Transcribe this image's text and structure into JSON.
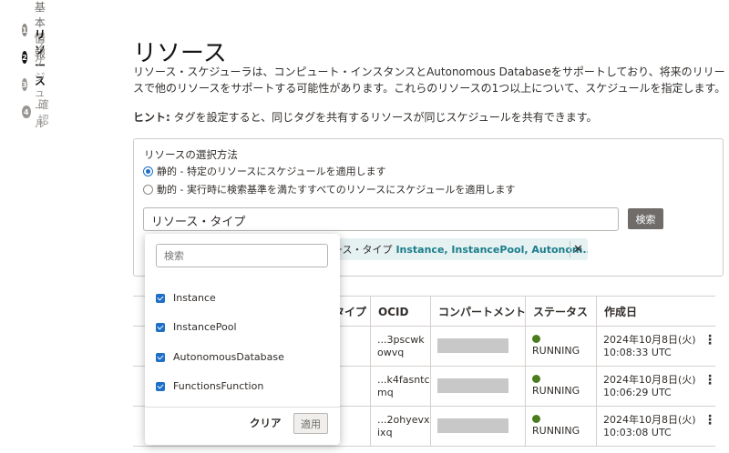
{
  "steps": [
    {
      "num": "1",
      "label": "基本情報"
    },
    {
      "num": "2",
      "label": "リソース"
    },
    {
      "num": "3",
      "label": "スケジュール"
    },
    {
      "num": "4",
      "label": "確認"
    }
  ],
  "page": {
    "title": "リソース",
    "description": "リソース・スケジューラは、コンピュート・インスタンスとAutonomous Databaseをサポートしており、将来のリリースで他のリソースをサポートする可能性があります。これらのリソースの1つ以上について、スケジュールを指定します。",
    "hint_label": "ヒント:",
    "hint_text": " タグを設定すると、同じタグを共有するリソースが同じスケジュールを共有できます。"
  },
  "selection": {
    "label": "リソースの選択方法",
    "options": [
      {
        "label": "静的 - 特定のリソースにスケジュールを適用します",
        "selected": true
      },
      {
        "label": "動的 - 実行時に検索基準を満たすすべてのリソースにスケジュールを適用します",
        "selected": false
      }
    ],
    "type_input_value": "リソース・タイプ",
    "search_button": "検索",
    "chip_key": "ース・タイプ",
    "chip_value": "Instance, InstancePool, Autonom...",
    "chip_close": "✕"
  },
  "table": {
    "headers": [
      "タイプ",
      "OCID",
      "コンパートメント",
      "ステータス",
      "作成日"
    ],
    "rows": [
      {
        "ocid_line1": "...3pscwk",
        "ocid_line2": "owvq",
        "status": "RUNNING",
        "created_line1": "2024年10月8日(火)",
        "created_line2": "10:08:33 UTC"
      },
      {
        "ocid_line1": "...k4fasntc",
        "ocid_line2": "mq",
        "status": "RUNNING",
        "created_line1": "2024年10月8日(火)",
        "created_line2": "10:06:29 UTC"
      },
      {
        "ocid_line1": "...2ohyevx",
        "ocid_line2": "ixq",
        "status": "RUNNING",
        "created_line1": "2024年10月8日(火)",
        "created_line2": "10:03:08 UTC"
      }
    ],
    "row_menu_glyph": "⋮"
  },
  "dropdown": {
    "search_placeholder": "検索",
    "items": [
      {
        "label": "Instance",
        "checked": true
      },
      {
        "label": "InstancePool",
        "checked": true
      },
      {
        "label": "AutonomousDatabase",
        "checked": true
      },
      {
        "label": "FunctionsFunction",
        "checked": true
      }
    ],
    "clear_label": "クリア",
    "apply_label": "適用"
  },
  "colors": {
    "accent_blue": "#1e6fc7",
    "chip_bg": "#e6f1f2",
    "chip_text": "#1a7d8a",
    "running_green": "#4b7d1e",
    "button_gray": "#6f6c69"
  }
}
